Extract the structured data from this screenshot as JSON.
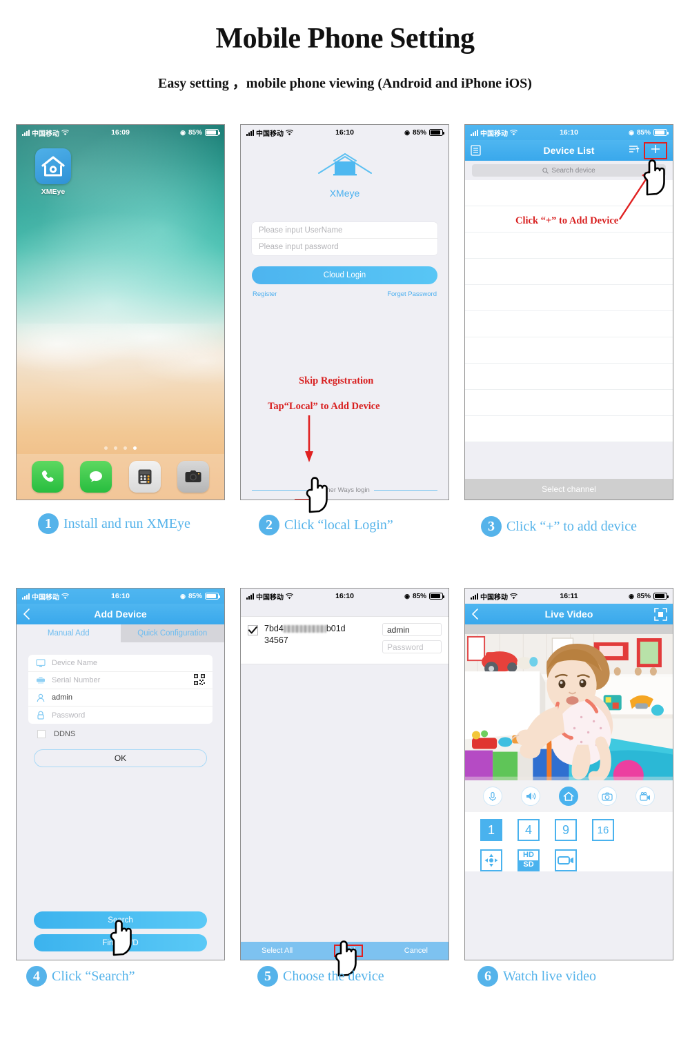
{
  "header": {
    "title": "Mobile Phone Setting",
    "subtitle": "Easy setting ，mobile phone viewing (Android and iPhone iOS)"
  },
  "status_bars": {
    "carrier": "中国移动",
    "time_1609": "16:09",
    "time_1610": "16:10",
    "time_1611": "16:11",
    "battery": "85%"
  },
  "panel1": {
    "app_label": "XMEye",
    "app_icon": "xmeye-house-camera-icon",
    "dock": [
      {
        "name": "phone-icon",
        "label": "Phone"
      },
      {
        "name": "messages-icon",
        "label": "Messages"
      },
      {
        "name": "calculator-icon",
        "label": "Calculator"
      },
      {
        "name": "camera-icon",
        "label": "Camera"
      }
    ],
    "page_dots": 4,
    "active_dot": 4
  },
  "panel2": {
    "brand": "XMeye",
    "username_placeholder": "Please input UserName",
    "password_placeholder": "Please input password",
    "cloud_login": "Cloud Login",
    "register": "Register",
    "forget_password": "Forget Password",
    "other_ways": "Other Ways login",
    "local_icon": "monitor-icon",
    "wifi_icon": "wifi-icon",
    "annotation_line1": "Skip Registration",
    "annotation_line2": "Tap“Local” to Add Device"
  },
  "panel3": {
    "title": "Device List",
    "menu_icon": "list-menu-icon",
    "sort_icon": "sort-icon",
    "add_icon": "plus-icon",
    "search_placeholder": "Search device",
    "select_channel": "Select channel",
    "annotation": "Click “+” to Add Device"
  },
  "panel4": {
    "title": "Add Device",
    "back_icon": "chevron-left-icon",
    "tabs": [
      {
        "label": "Manual Add",
        "active": true
      },
      {
        "label": "Quick Configuration",
        "active": false
      }
    ],
    "fields": [
      {
        "icon": "monitor-icon",
        "value": "Device Name",
        "filled": false
      },
      {
        "icon": "server-icon",
        "value": "Serial Number",
        "filled": false,
        "trailing_icon": "qr-code-icon"
      },
      {
        "icon": "person-icon",
        "value": "admin",
        "filled": true
      },
      {
        "icon": "lock-icon",
        "value": "Password",
        "filled": false
      }
    ],
    "ddns_label": "DDNS",
    "ok_button": "OK",
    "search_button": "Search",
    "find_pwd_button": "Find PWD"
  },
  "panel5": {
    "device_sn_prefix": "7bd4",
    "device_sn_suffix": "b01d",
    "device_sn_line2": "34567",
    "username_value": "admin",
    "password_placeholder": "Password",
    "checkbox_checked": true,
    "select_all": "Select All",
    "add": "Add",
    "cancel": "Cancel"
  },
  "panel6": {
    "title": "Live Video",
    "back_icon": "chevron-left-icon",
    "fullscreen_icon": "fullscreen-icon",
    "controls": [
      {
        "name": "microphone-icon",
        "active": false
      },
      {
        "name": "speaker-icon",
        "active": false
      },
      {
        "name": "home-icon",
        "active": true
      },
      {
        "name": "snapshot-camera-icon",
        "active": false
      },
      {
        "name": "video-record-icon",
        "active": false
      }
    ],
    "split_views": [
      {
        "label": "1",
        "active": true
      },
      {
        "label": "4",
        "active": false
      },
      {
        "label": "9",
        "active": false
      },
      {
        "label": "16",
        "active": false
      }
    ],
    "tools": [
      {
        "name": "ptz-direction-icon",
        "label": ""
      },
      {
        "name": "hd-sd-toggle-icon",
        "label_top": "HD",
        "label_bottom": "SD"
      },
      {
        "name": "record-video-icon",
        "label": ""
      }
    ]
  },
  "captions": [
    {
      "num": "1",
      "text": "Install and run XMEye"
    },
    {
      "num": "2",
      "text": "Click “local Login”"
    },
    {
      "num": "3",
      "text": "Click “+” to add device"
    },
    {
      "num": "4",
      "text": "Click “Search”"
    },
    {
      "num": "5",
      "text": "Choose the device"
    },
    {
      "num": "6",
      "text": "Watch live video"
    }
  ],
  "colors": {
    "accent_blue": "#49b2ee",
    "caption_blue": "#55b3ea",
    "annotation_red": "#d81f1f",
    "navbar_blue": "#39a8ec"
  }
}
